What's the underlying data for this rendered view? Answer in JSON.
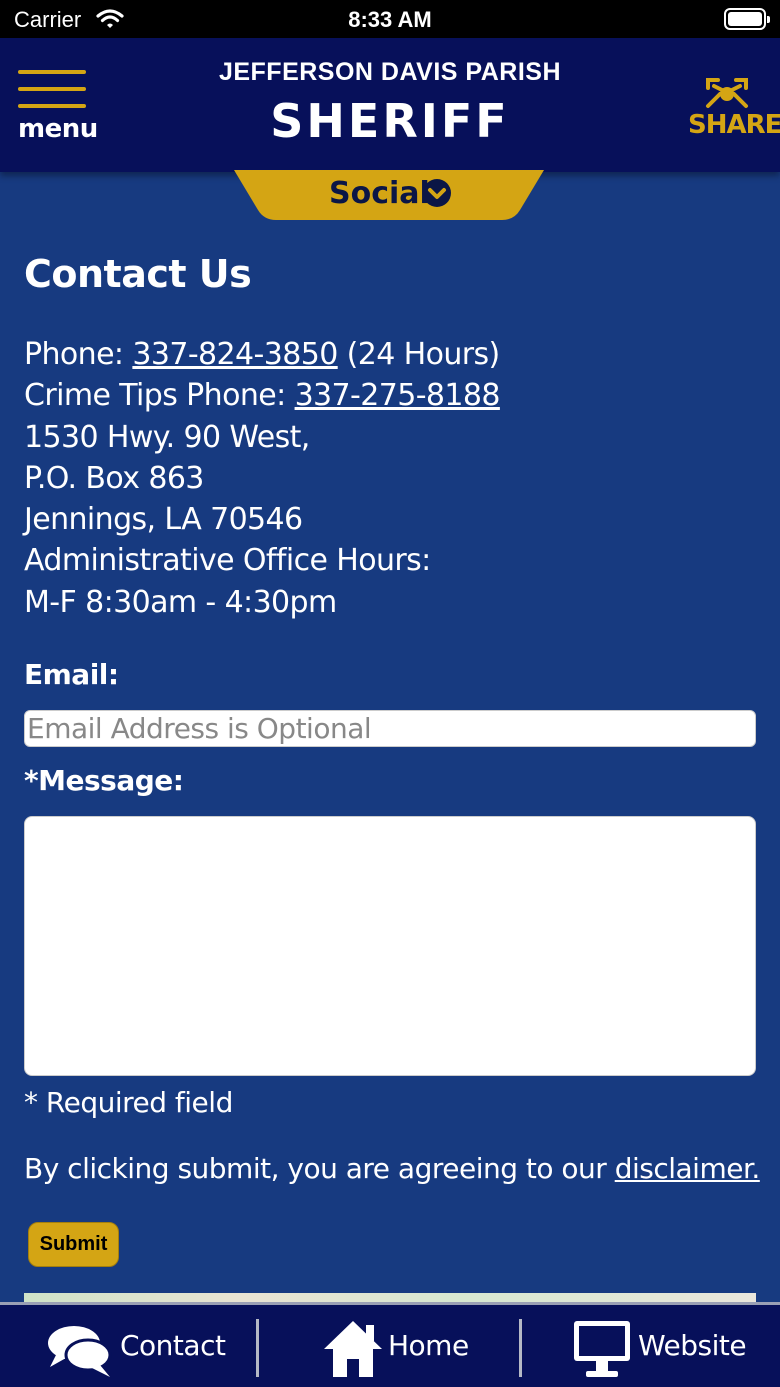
{
  "status_bar": {
    "carrier": "Carrier",
    "time": "8:33 AM"
  },
  "header": {
    "menu_label": "menu",
    "title_line1": "JEFFERSON DAVIS PARISH",
    "title_line2": "SHERIFF",
    "share_label": "SHARE"
  },
  "social_tab": {
    "label": "Social"
  },
  "contact": {
    "title": "Contact Us",
    "phone_prefix": "Phone: ",
    "phone": "337-824-3850",
    "phone_suffix": " (24 Hours)",
    "tips_prefix": "Crime Tips Phone: ",
    "tips_phone": "337-275-8188",
    "address1": "1530 Hwy. 90 West,",
    "address2": "P.O. Box 863",
    "address3": "Jennings, LA 70546",
    "hours_label": "Administrative Office Hours:",
    "hours": "M-F 8:30am - 4:30pm"
  },
  "form": {
    "email_label": "Email:",
    "email_placeholder": "Email Address is Optional",
    "email_value": "",
    "message_label": "*Message:",
    "message_value": "",
    "required_note": "* Required field",
    "disclaimer_prefix": "By clicking submit, you are agreeing to our ",
    "disclaimer_link": "disclaimer.",
    "submit_label": "Submit"
  },
  "tab_bar": [
    {
      "label": "Contact",
      "icon": "chat-bubbles-icon"
    },
    {
      "label": "Home",
      "icon": "house-icon"
    },
    {
      "label": "Website",
      "icon": "monitor-icon"
    }
  ],
  "colors": {
    "background": "#173a80",
    "header": "#07105a",
    "accent_gold": "#d4a514"
  }
}
